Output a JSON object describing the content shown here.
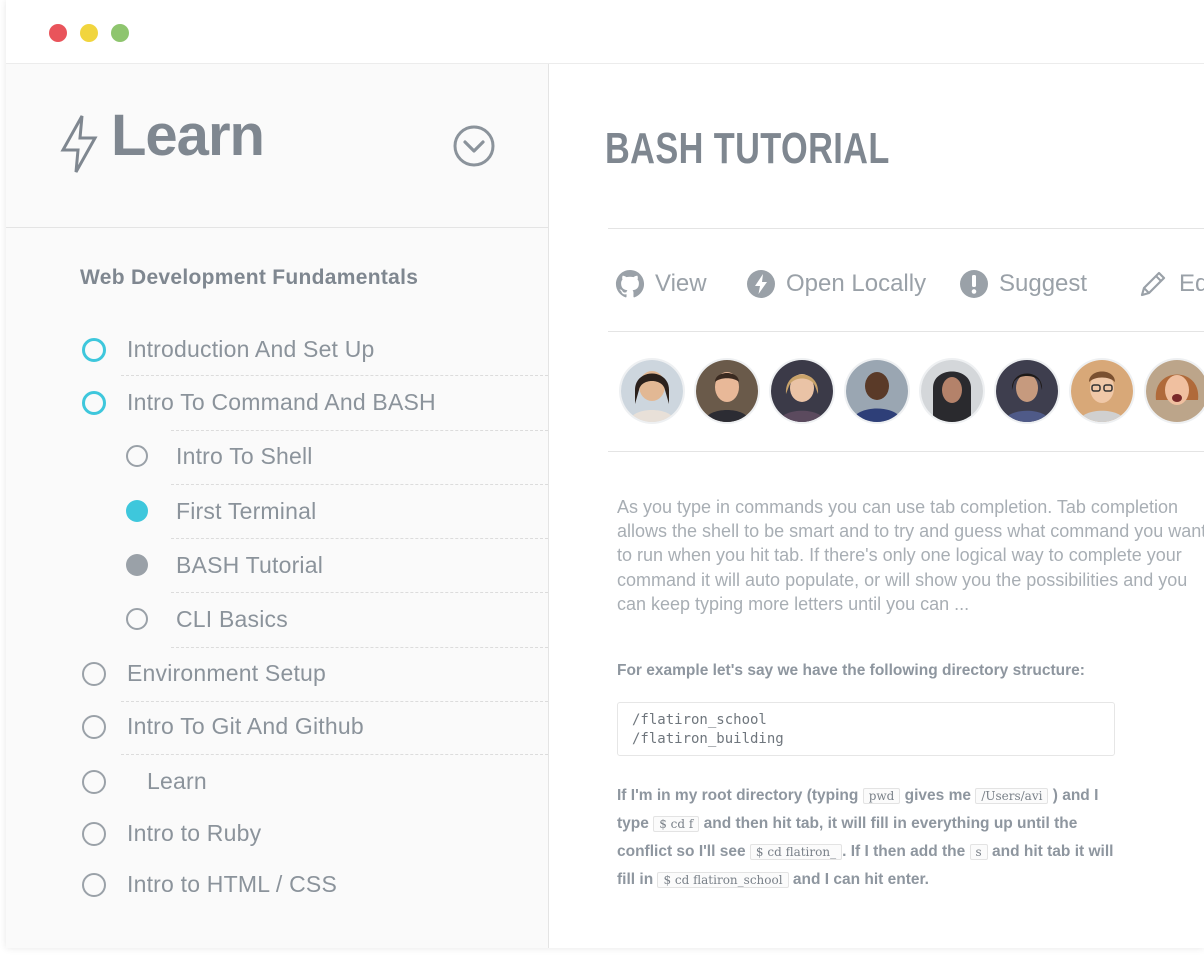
{
  "window": {
    "controls": [
      "close",
      "minimize",
      "maximize"
    ]
  },
  "sidebar": {
    "logo_text": "Learn",
    "section_title": "Web Development Fundamentals",
    "items": [
      {
        "label": "Introduction And Set Up",
        "state": "in-progress"
      },
      {
        "label": "Intro To Command And BASH",
        "state": "in-progress"
      },
      {
        "label": "Intro To Shell",
        "state": "incomplete"
      },
      {
        "label": "First Terminal",
        "state": "complete"
      },
      {
        "label": "BASH Tutorial",
        "state": "current"
      },
      {
        "label": "CLI Basics",
        "state": "incomplete"
      },
      {
        "label": "Environment Setup",
        "state": "incomplete"
      },
      {
        "label": "Intro To Git And Github",
        "state": "incomplete"
      },
      {
        "label": "Learn",
        "state": "incomplete"
      },
      {
        "label": "Intro to Ruby",
        "state": "incomplete"
      },
      {
        "label": "Intro to HTML / CSS",
        "state": "incomplete"
      }
    ]
  },
  "main": {
    "title": "BASH TUTORIAL",
    "actions": [
      {
        "label": "View",
        "icon": "github-icon"
      },
      {
        "label": "Open Locally",
        "icon": "bolt-circle-icon"
      },
      {
        "label": "Suggest",
        "icon": "exclamation-circle-icon"
      },
      {
        "label": "Ed",
        "icon": "pencil-icon"
      }
    ],
    "body_text": "As you type in commands you can use tab completion. Tab completion allows the shell to be smart and to try and guess what command you want to run when you hit tab. If there's only one logical way to complete your command it will auto populate, or will show you the possibilities and you can keep typing more letters until you can ...",
    "example_text": "For example let's say we have the following directory structure:",
    "code_lines": [
      "/flatiron_school",
      "/flatiron_building"
    ],
    "paragraph": {
      "p1": "If I'm in my root directory (typing",
      "c1": "pwd",
      "p2": "gives me",
      "c2": "/Users/avi",
      "p3": ") and I type",
      "c3": "$ cd f",
      "p4": "and then hit tab, it will fill in everything up until the conflict so I'll see",
      "c4": "$ cd flatiron_",
      "p5": ". If I then add the",
      "c5": "s",
      "p6": "and hit tab it will fill in",
      "c6": "$ cd flatiron_school",
      "p7": "and I can hit enter."
    }
  },
  "colors": {
    "accent": "#3ec7dc",
    "muted": "#8e969f",
    "current_fill": "#9aa1a8",
    "close": "#e9545b",
    "minimize": "#f1d53e",
    "maximize": "#8ec56e"
  }
}
